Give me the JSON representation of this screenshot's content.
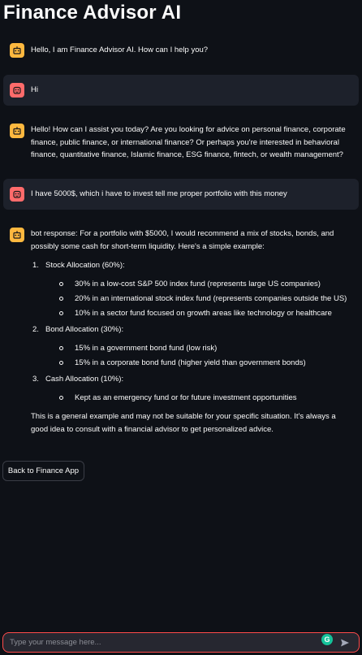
{
  "header": {
    "title": "Finance Advisor AI"
  },
  "colors": {
    "background": "#0e1117",
    "user_bubble": "#1d212b",
    "bot_avatar": "#fdb83f",
    "user_avatar": "#ff6b6b",
    "accent": "#ff4b4b"
  },
  "messages": [
    {
      "role": "assistant",
      "icon": "bot-icon",
      "text": "Hello, I am Finance Advisor AI. How can I help you?"
    },
    {
      "role": "user",
      "icon": "user-face-icon",
      "text": "Hi"
    },
    {
      "role": "assistant",
      "icon": "bot-icon",
      "text": "Hello! How can I assist you today? Are you looking for advice on personal finance, corporate finance, public finance, or international finance? Or perhaps you're interested in behavioral finance, quantitative finance, Islamic finance, ESG finance, fintech, or wealth management?"
    },
    {
      "role": "user",
      "icon": "user-face-icon",
      "text": "I have 5000$, which i have to invest tell me proper portfolio with this money"
    },
    {
      "role": "assistant",
      "icon": "bot-icon",
      "intro": "bot response: For a portfolio with $5000, I would recommend a mix of stocks, bonds, and possibly some cash for short-term liquidity. Here's a simple example:",
      "sections": [
        {
          "num": "1.",
          "title": "Stock Allocation (60%):",
          "items": [
            "30% in a low-cost S&P 500 index fund (represents large US companies)",
            "20% in an international stock index fund (represents companies outside the US)",
            "10% in a sector fund focused on growth areas like technology or healthcare"
          ]
        },
        {
          "num": "2.",
          "title": "Bond Allocation (30%):",
          "items": [
            "15% in a government bond fund (low risk)",
            "15% in a corporate bond fund (higher yield than government bonds)"
          ]
        },
        {
          "num": "3.",
          "title": "Cash Allocation (10%):",
          "items": [
            "Kept as an emergency fund or for future investment opportunities"
          ]
        }
      ],
      "closing": "This is a general example and may not be suitable for your specific situation. It's always a good idea to consult with a financial advisor to get personalized advice."
    }
  ],
  "back_button": {
    "label": "Back to Finance App"
  },
  "chat_input": {
    "placeholder": "Type your message here...",
    "value": ""
  },
  "icons": {
    "send": "send-icon",
    "grammarly": "grammarly-icon"
  }
}
